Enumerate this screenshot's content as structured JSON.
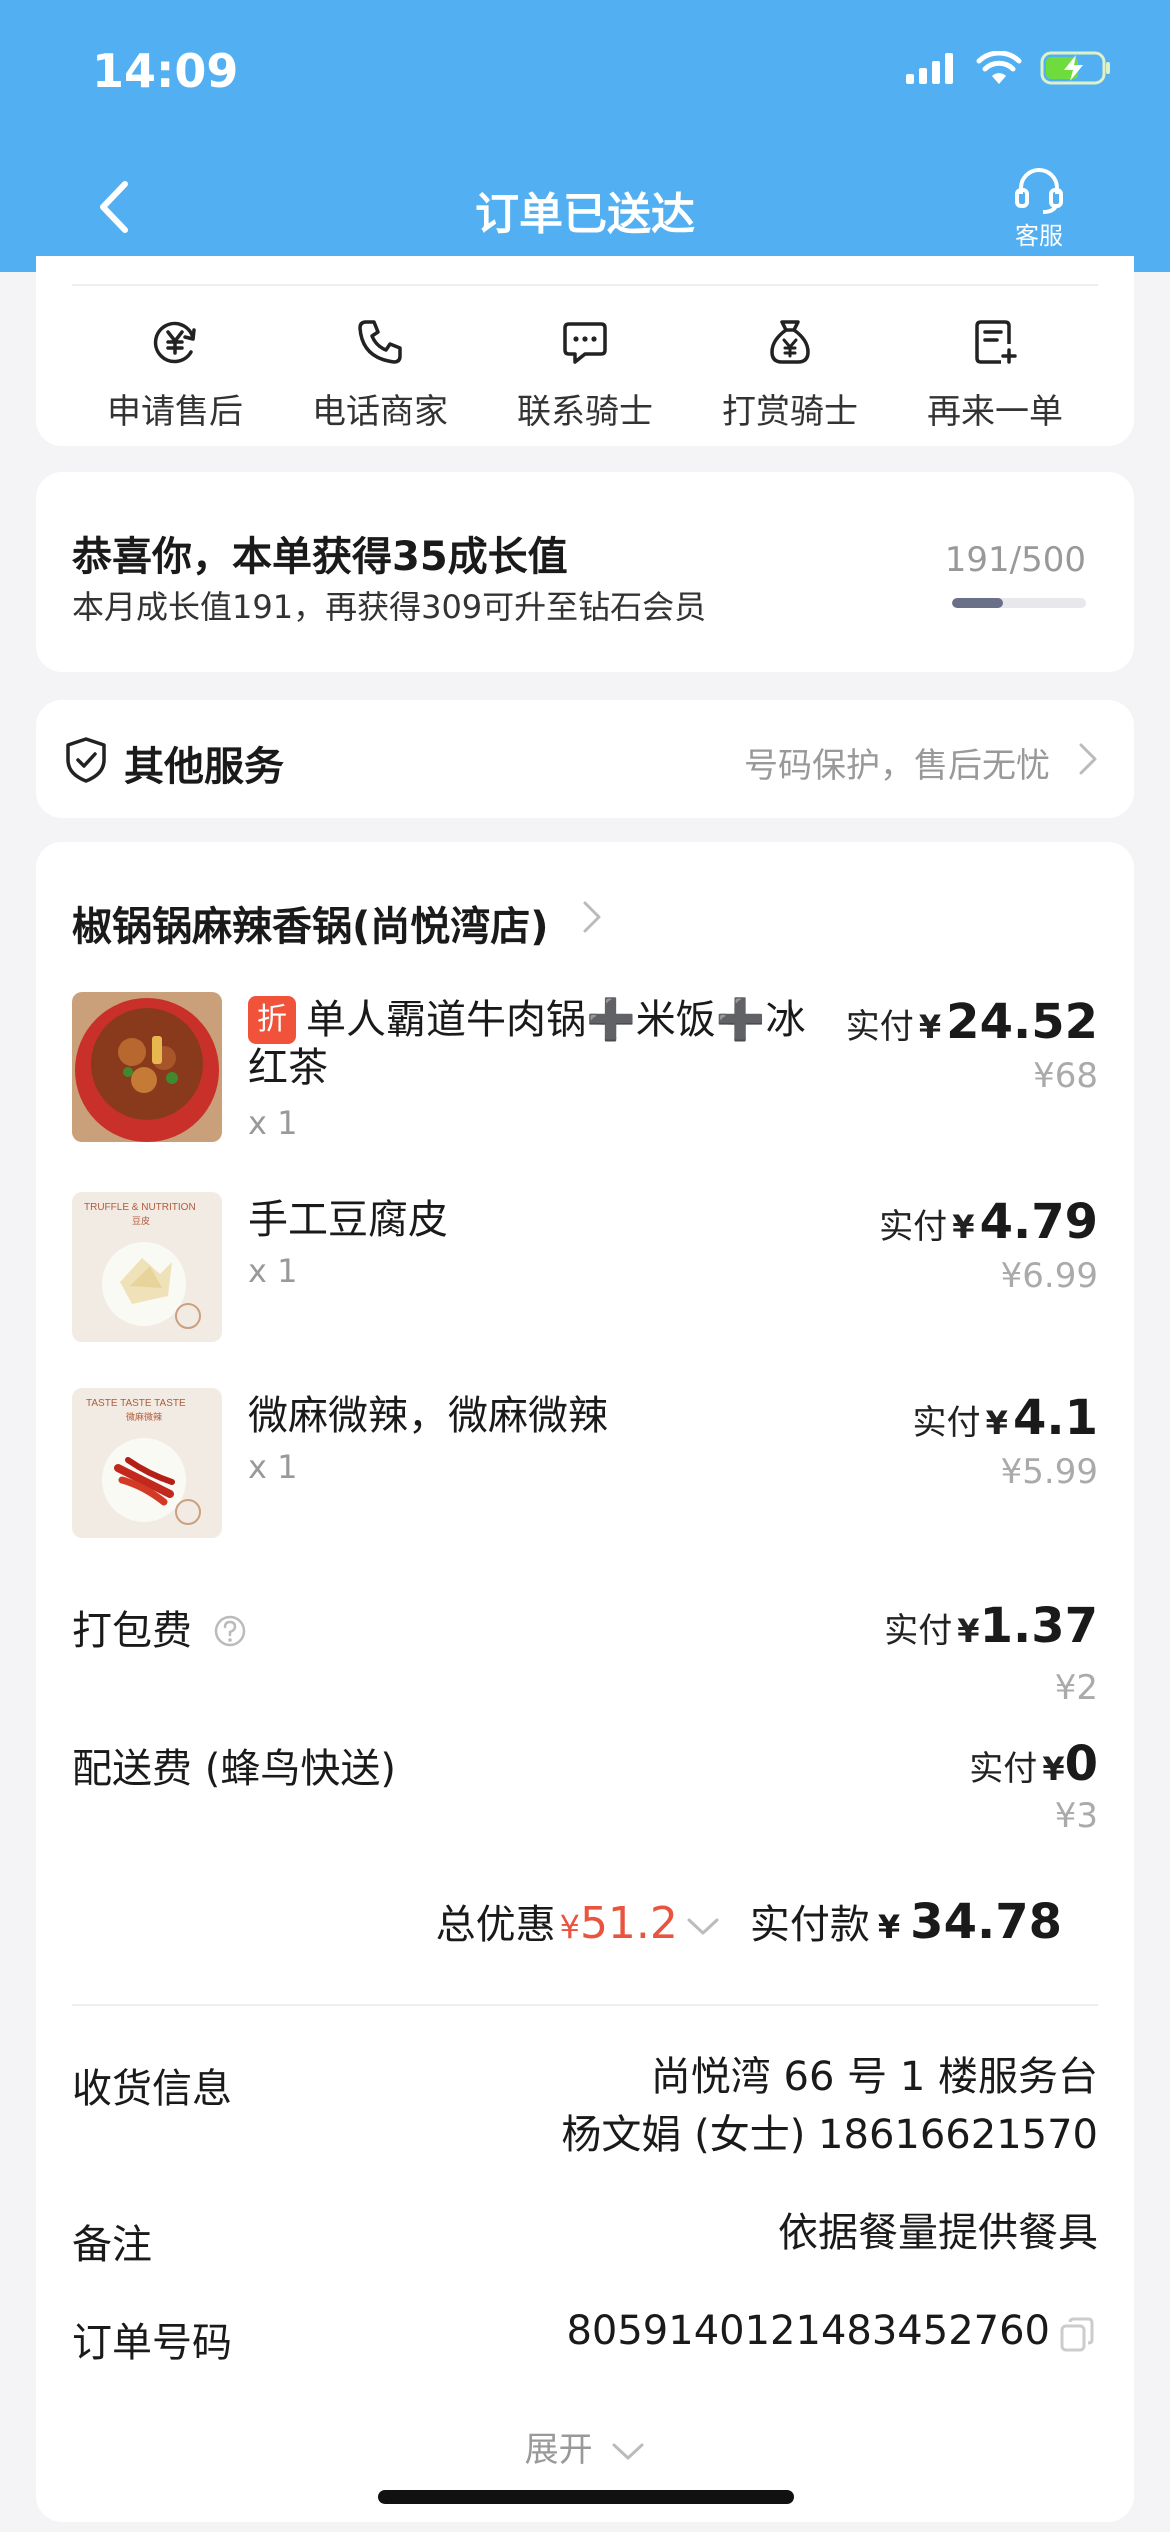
{
  "status_bar": {
    "time": "14:09"
  },
  "nav": {
    "title": "订单已送达",
    "service_label": "客服"
  },
  "actions": [
    {
      "label": "申请售后",
      "icon": "yuan-refresh-icon"
    },
    {
      "label": "电话商家",
      "icon": "phone-icon"
    },
    {
      "label": "联系骑士",
      "icon": "chat-icon"
    },
    {
      "label": "打赏骑士",
      "icon": "money-bag-icon"
    },
    {
      "label": "再来一单",
      "icon": "reorder-icon"
    }
  ],
  "growth": {
    "title": "恭喜你，本单获得35成长值",
    "subtitle": "本月成长值191，再获得309可升至钻石会员",
    "count": "191/500",
    "progress": 0.382
  },
  "other_services": {
    "title": "其他服务",
    "description": "号码保护，售后无忧"
  },
  "order": {
    "shop_name": "椒锅锅麻辣香锅(尚悦湾店)",
    "items": [
      {
        "tag": "折",
        "name": "单人霸道牛肉锅➕米饭➕冰红茶",
        "qty": "x 1",
        "pay_label": "实付",
        "currency": "¥",
        "pay": "24.52",
        "original": "¥68"
      },
      {
        "name": "手工豆腐皮",
        "qty": "x 1",
        "pay_label": "实付",
        "currency": "¥",
        "pay": "4.79",
        "original": "¥6.99",
        "img_caption": "TRUFFLE & NUTRITION",
        "img_subcaption": "豆皮"
      },
      {
        "name": "微麻微辣，微麻微辣",
        "qty": "x 1",
        "pay_label": "实付",
        "currency": "¥",
        "pay": "4.1",
        "original": "¥5.99",
        "img_caption": "TASTE TASTE TASTE",
        "img_subcaption": "微麻微辣"
      }
    ],
    "packing_fee": {
      "label": "打包费",
      "pay_label": "实付",
      "currency": "¥",
      "pay": "1.37",
      "original": "¥2"
    },
    "delivery_fee": {
      "label": "配送费 (蜂鸟快送)",
      "pay_label": "实付",
      "currency": "¥",
      "pay": "0",
      "original": "¥3"
    },
    "totals": {
      "discount_label": "总优惠",
      "discount_currency": "¥",
      "discount": "51.2",
      "paid_label": "实付款",
      "paid_currency": "¥",
      "paid": "34.78"
    },
    "delivery_info": {
      "label": "收货信息",
      "address": "尚悦湾 66 号 1 楼服务台",
      "contact": "杨文娟 (女士) 18616621570"
    },
    "note": {
      "label": "备注",
      "value": "依据餐量提供餐具"
    },
    "order_number": {
      "label": "订单号码",
      "value": "8059140121483452760"
    },
    "expand_label": "展开"
  },
  "colors": {
    "header_bg": "#52b0f2",
    "accent_red": "#e8543d",
    "tag_red": "#f0533a"
  }
}
